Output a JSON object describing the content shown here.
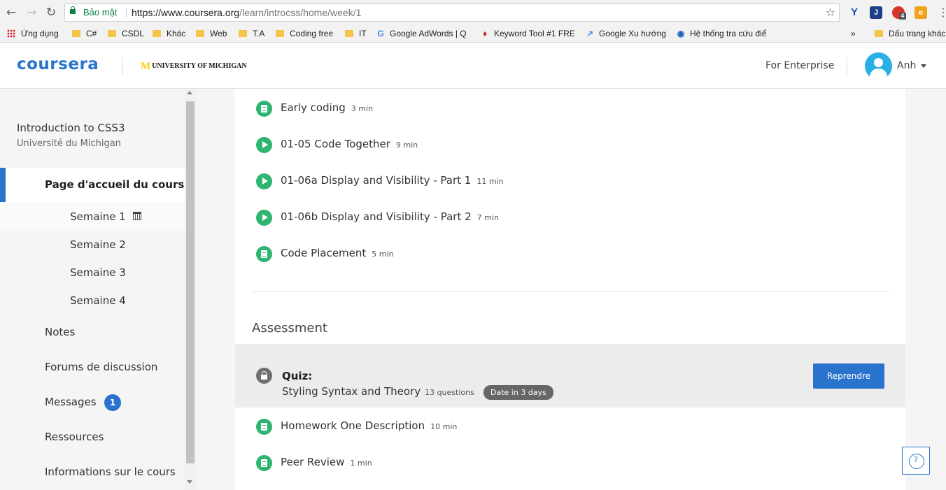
{
  "browser": {
    "secure_label": "Bảo mật",
    "url_host": "https://www.coursera.org",
    "url_path": "/learn/introcss/home/week/1",
    "bookmarks": [
      {
        "label": "Ứng dụng",
        "icon": "apps-grid-icon"
      },
      {
        "label": "C#",
        "icon": "folder-icon"
      },
      {
        "label": "CSDL",
        "icon": "folder-icon"
      },
      {
        "label": "Khác",
        "icon": "folder-icon"
      },
      {
        "label": "Web",
        "icon": "folder-icon"
      },
      {
        "label": "T.A",
        "icon": "folder-icon"
      },
      {
        "label": "Coding free",
        "icon": "folder-icon"
      },
      {
        "label": "IT",
        "icon": "folder-icon"
      },
      {
        "label": "Google AdWords | Q",
        "icon": "google-icon"
      },
      {
        "label": "Keyword Tool #1 FRE",
        "icon": "keyword-tool-icon"
      },
      {
        "label": "Google Xu hướng",
        "icon": "trends-icon"
      },
      {
        "label": "Hệ thống tra cứu điể",
        "icon": "globe-icon"
      }
    ],
    "overflow_label": "»",
    "other_bookmarks": "Dấu trang khác",
    "extension_badge": "4"
  },
  "header": {
    "logo": "coursera",
    "partner": "UNIVERSITY OF MICHIGAN",
    "partner_mark": "M",
    "enterprise_link": "For Enterprise",
    "user_name": "Anh"
  },
  "sidebar": {
    "course_title": "Introduction to CSS3",
    "university": "Université du Michigan",
    "home_label": "Page d'accueil du cours",
    "weeks": [
      "Semaine 1",
      "Semaine 2",
      "Semaine 3",
      "Semaine 4"
    ],
    "links": {
      "notes": "Notes",
      "forums": "Forums de discussion",
      "messages": "Messages",
      "resources": "Ressources",
      "info": "Informations sur le cours"
    },
    "messages_count": "1"
  },
  "items": [
    {
      "type": "reading",
      "title": "Early coding",
      "duration": "3 min"
    },
    {
      "type": "video",
      "title": "01-05 Code Together",
      "duration": "9 min"
    },
    {
      "type": "video",
      "title": "01-06a Display and Visibility - Part 1",
      "duration": "11 min"
    },
    {
      "type": "video",
      "title": "01-06b Display and Visibility - Part 2",
      "duration": "7 min"
    },
    {
      "type": "reading",
      "title": "Code Placement",
      "duration": "5 min"
    }
  ],
  "assessment": {
    "section_title": "Assessment",
    "quiz_type": "Quiz:",
    "quiz_title": "Styling Syntax and Theory",
    "quiz_count": "13 questions",
    "due_label": "Date in 3 days",
    "retake_button": "Reprendre"
  },
  "after_items": [
    {
      "type": "reading",
      "title": "Homework One Description",
      "duration": "10 min"
    },
    {
      "type": "reading",
      "title": "Peer Review",
      "duration": "1 min"
    }
  ],
  "help_label": "?",
  "colors": {
    "accent": "#2a73cc",
    "success": "#2db571",
    "sidebar_bg": "#f5f5f5"
  }
}
